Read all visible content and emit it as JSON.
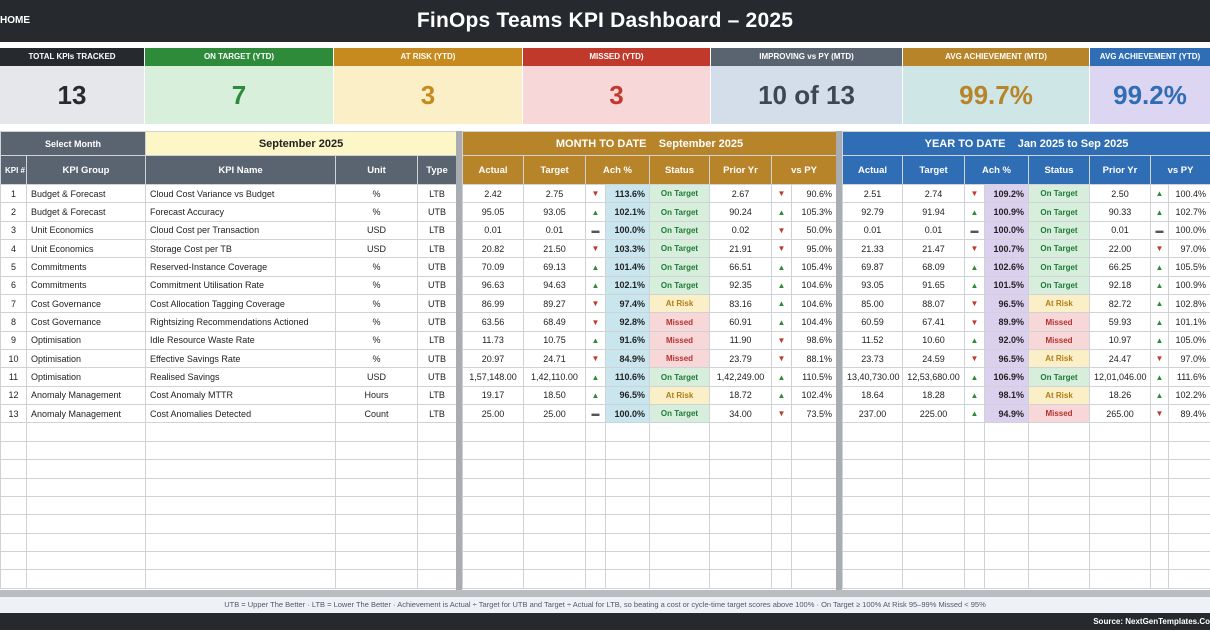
{
  "header": {
    "home_label": "HOME",
    "title": "FinOps Teams KPI Dashboard   –   2025"
  },
  "cards": [
    {
      "label": "TOTAL KPIs TRACKED",
      "value": "13",
      "head_color": "#262a2f",
      "bg": "#e5e7ea",
      "value_color": "#262a2f"
    },
    {
      "label": "ON TARGET (YTD)",
      "value": "7",
      "head_color": "#2e8b3a",
      "bg": "#d8efdc",
      "value_color": "#2e8b3a"
    },
    {
      "label": "AT RISK (YTD)",
      "value": "3",
      "head_color": "#c78a1e",
      "bg": "#fbefc8",
      "value_color": "#c78a1e"
    },
    {
      "label": "MISSED (YTD)",
      "value": "3",
      "head_color": "#c0392b",
      "bg": "#f7d7d7",
      "value_color": "#c0392b"
    },
    {
      "label": "IMPROVING vs PY (MTD)",
      "value": "10 of 13",
      "head_color": "#5a6470",
      "bg": "#d4deea",
      "value_color": "#3d4651"
    },
    {
      "label": "AVG ACHIEVEMENT (MTD)",
      "value": "99.7%",
      "head_color": "#b8842a",
      "bg": "#cfe6e6",
      "value_color": "#b8842a"
    },
    {
      "label": "AVG ACHIEVEMENT (YTD)",
      "value": "99.2%",
      "head_color": "#2f6db5",
      "bg": "#ddd6f2",
      "value_color": "#2f6db5"
    }
  ],
  "select": {
    "label": "Select Month",
    "value": "September 2025"
  },
  "mtd": {
    "title": "MONTH TO DATE",
    "period": "September 2025"
  },
  "ytd": {
    "title": "YEAR TO DATE",
    "period": "Jan 2025  to  Sep 2025"
  },
  "left_columns": [
    "KPI #",
    "KPI Group",
    "KPI Name",
    "Unit",
    "Type"
  ],
  "perf_columns": [
    "Actual",
    "Target",
    "Ach %",
    "Status",
    "Prior Yr",
    "vs PY"
  ],
  "rows": [
    {
      "n": "1",
      "group": "Budget & Forecast",
      "name": "Cloud Cost Variance vs Budget",
      "unit": "%",
      "type": "LTB",
      "mtd": {
        "actual": "2.42",
        "target": "2.75",
        "arrow": "down",
        "ach": "113.6%",
        "status": "On Target",
        "py": "2.67",
        "pyarrow": "down",
        "vspy": "90.6%"
      },
      "ytd": {
        "actual": "2.51",
        "target": "2.74",
        "arrow": "down",
        "ach": "109.2%",
        "status": "On Target",
        "py": "2.50",
        "pyarrow": "up",
        "vspy": "100.4%"
      }
    },
    {
      "n": "2",
      "group": "Budget & Forecast",
      "name": "Forecast Accuracy",
      "unit": "%",
      "type": "UTB",
      "mtd": {
        "actual": "95.05",
        "target": "93.05",
        "arrow": "up",
        "ach": "102.1%",
        "status": "On Target",
        "py": "90.24",
        "pyarrow": "up",
        "vspy": "105.3%"
      },
      "ytd": {
        "actual": "92.79",
        "target": "91.94",
        "arrow": "up",
        "ach": "100.9%",
        "status": "On Target",
        "py": "90.33",
        "pyarrow": "up",
        "vspy": "102.7%"
      }
    },
    {
      "n": "3",
      "group": "Unit Economics",
      "name": "Cloud Cost per Transaction",
      "unit": "USD",
      "type": "LTB",
      "mtd": {
        "actual": "0.01",
        "target": "0.01",
        "arrow": "flat",
        "ach": "100.0%",
        "status": "On Target",
        "py": "0.02",
        "pyarrow": "down",
        "vspy": "50.0%"
      },
      "ytd": {
        "actual": "0.01",
        "target": "0.01",
        "arrow": "flat",
        "ach": "100.0%",
        "status": "On Target",
        "py": "0.01",
        "pyarrow": "flat",
        "vspy": "100.0%"
      }
    },
    {
      "n": "4",
      "group": "Unit Economics",
      "name": "Storage Cost per TB",
      "unit": "USD",
      "type": "LTB",
      "mtd": {
        "actual": "20.82",
        "target": "21.50",
        "arrow": "down",
        "ach": "103.3%",
        "status": "On Target",
        "py": "21.91",
        "pyarrow": "down",
        "vspy": "95.0%"
      },
      "ytd": {
        "actual": "21.33",
        "target": "21.47",
        "arrow": "down",
        "ach": "100.7%",
        "status": "On Target",
        "py": "22.00",
        "pyarrow": "down",
        "vspy": "97.0%"
      }
    },
    {
      "n": "5",
      "group": "Commitments",
      "name": "Reserved-Instance Coverage",
      "unit": "%",
      "type": "UTB",
      "mtd": {
        "actual": "70.09",
        "target": "69.13",
        "arrow": "up",
        "ach": "101.4%",
        "status": "On Target",
        "py": "66.51",
        "pyarrow": "up",
        "vspy": "105.4%"
      },
      "ytd": {
        "actual": "69.87",
        "target": "68.09",
        "arrow": "up",
        "ach": "102.6%",
        "status": "On Target",
        "py": "66.25",
        "pyarrow": "up",
        "vspy": "105.5%"
      }
    },
    {
      "n": "6",
      "group": "Commitments",
      "name": "Commitment Utilisation Rate",
      "unit": "%",
      "type": "UTB",
      "mtd": {
        "actual": "96.63",
        "target": "94.63",
        "arrow": "up",
        "ach": "102.1%",
        "status": "On Target",
        "py": "92.35",
        "pyarrow": "up",
        "vspy": "104.6%"
      },
      "ytd": {
        "actual": "93.05",
        "target": "91.65",
        "arrow": "up",
        "ach": "101.5%",
        "status": "On Target",
        "py": "92.18",
        "pyarrow": "up",
        "vspy": "100.9%"
      }
    },
    {
      "n": "7",
      "group": "Cost Governance",
      "name": "Cost Allocation Tagging Coverage",
      "unit": "%",
      "type": "UTB",
      "mtd": {
        "actual": "86.99",
        "target": "89.27",
        "arrow": "down",
        "ach": "97.4%",
        "status": "At Risk",
        "py": "83.16",
        "pyarrow": "up",
        "vspy": "104.6%"
      },
      "ytd": {
        "actual": "85.00",
        "target": "88.07",
        "arrow": "down",
        "ach": "96.5%",
        "status": "At Risk",
        "py": "82.72",
        "pyarrow": "up",
        "vspy": "102.8%"
      }
    },
    {
      "n": "8",
      "group": "Cost Governance",
      "name": "Rightsizing Recommendations Actioned",
      "unit": "%",
      "type": "UTB",
      "mtd": {
        "actual": "63.56",
        "target": "68.49",
        "arrow": "down",
        "ach": "92.8%",
        "status": "Missed",
        "py": "60.91",
        "pyarrow": "up",
        "vspy": "104.4%"
      },
      "ytd": {
        "actual": "60.59",
        "target": "67.41",
        "arrow": "down",
        "ach": "89.9%",
        "status": "Missed",
        "py": "59.93",
        "pyarrow": "up",
        "vspy": "101.1%"
      }
    },
    {
      "n": "9",
      "group": "Optimisation",
      "name": "Idle Resource Waste Rate",
      "unit": "%",
      "type": "LTB",
      "mtd": {
        "actual": "11.73",
        "target": "10.75",
        "arrow": "up",
        "ach": "91.6%",
        "status": "Missed",
        "py": "11.90",
        "pyarrow": "down",
        "vspy": "98.6%"
      },
      "ytd": {
        "actual": "11.52",
        "target": "10.60",
        "arrow": "up",
        "ach": "92.0%",
        "status": "Missed",
        "py": "10.97",
        "pyarrow": "up",
        "vspy": "105.0%"
      }
    },
    {
      "n": "10",
      "group": "Optimisation",
      "name": "Effective Savings Rate",
      "unit": "%",
      "type": "UTB",
      "mtd": {
        "actual": "20.97",
        "target": "24.71",
        "arrow": "down",
        "ach": "84.9%",
        "status": "Missed",
        "py": "23.79",
        "pyarrow": "down",
        "vspy": "88.1%"
      },
      "ytd": {
        "actual": "23.73",
        "target": "24.59",
        "arrow": "down",
        "ach": "96.5%",
        "status": "At Risk",
        "py": "24.47",
        "pyarrow": "down",
        "vspy": "97.0%"
      }
    },
    {
      "n": "11",
      "group": "Optimisation",
      "name": "Realised Savings",
      "unit": "USD",
      "type": "UTB",
      "mtd": {
        "actual": "1,57,148.00",
        "target": "1,42,110.00",
        "arrow": "up",
        "ach": "110.6%",
        "status": "On Target",
        "py": "1,42,249.00",
        "pyarrow": "up",
        "vspy": "110.5%"
      },
      "ytd": {
        "actual": "13,40,730.00",
        "target": "12,53,680.00",
        "arrow": "up",
        "ach": "106.9%",
        "status": "On Target",
        "py": "12,01,046.00",
        "pyarrow": "up",
        "vspy": "111.6%"
      }
    },
    {
      "n": "12",
      "group": "Anomaly Management",
      "name": "Cost Anomaly MTTR",
      "unit": "Hours",
      "type": "LTB",
      "mtd": {
        "actual": "19.17",
        "target": "18.50",
        "arrow": "up",
        "ach": "96.5%",
        "status": "At Risk",
        "py": "18.72",
        "pyarrow": "up",
        "vspy": "102.4%"
      },
      "ytd": {
        "actual": "18.64",
        "target": "18.28",
        "arrow": "up",
        "ach": "98.1%",
        "status": "At Risk",
        "py": "18.26",
        "pyarrow": "up",
        "vspy": "102.2%"
      }
    },
    {
      "n": "13",
      "group": "Anomaly Management",
      "name": "Cost Anomalies Detected",
      "unit": "Count",
      "type": "LTB",
      "mtd": {
        "actual": "25.00",
        "target": "25.00",
        "arrow": "flat",
        "ach": "100.0%",
        "status": "On Target",
        "py": "34.00",
        "pyarrow": "down",
        "vspy": "73.5%"
      },
      "ytd": {
        "actual": "237.00",
        "target": "225.00",
        "arrow": "up",
        "ach": "94.9%",
        "status": "Missed",
        "py": "265.00",
        "pyarrow": "down",
        "vspy": "89.4%"
      }
    }
  ],
  "footer": {
    "note": "UTB = Upper The Better   ·   LTB = Lower The Better   ·   Achievement is Actual ÷ Target for UTB and Target ÷ Actual for LTB, so beating a cost or cycle-time target scores above 100%   ·   On Target ≥ 100%   At Risk 95–99%   Missed < 95%",
    "source": "Source: NextGenTemplates.Co"
  }
}
